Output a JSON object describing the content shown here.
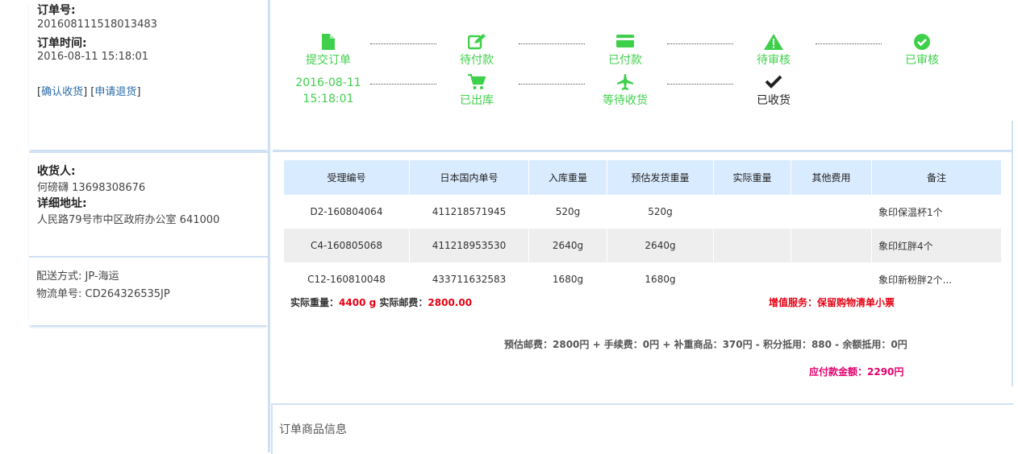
{
  "order": {
    "number_label": "订单号:",
    "number": "201608111518013483",
    "time_label": "订单时间:",
    "time": "2016-08-11 15:18:01",
    "confirm_link": "确认收货",
    "return_link": "申请退货"
  },
  "receiver": {
    "name_label": "收货人:",
    "name": "何磅礴",
    "phone": "13698308676",
    "address_label": "详细地址:",
    "address": "人民路79号市中区政府办公室 641000"
  },
  "shipping": {
    "method": "配送方式: JP-海运",
    "tracking": "物流单号: CD264326535JP"
  },
  "progress": {
    "row1": [
      {
        "label": "提交订单",
        "icon": "file-icon",
        "glyph": "▮"
      },
      {
        "label": "待付款",
        "icon": "edit-icon",
        "glyph": "✎"
      },
      {
        "label": "已付款",
        "icon": "credit-card-icon",
        "glyph": "▬"
      },
      {
        "label": "待审核",
        "icon": "warning-icon",
        "glyph": "⚠"
      },
      {
        "label": "已审核",
        "icon": "check-circle-icon",
        "glyph": "✔"
      }
    ],
    "row1_first_date": "2016-08-11",
    "row1_first_time": "15:18:01",
    "row2": [
      {
        "label": "已出库",
        "icon": "cart-icon",
        "glyph": "🛒"
      },
      {
        "label": "等待收货",
        "icon": "plane-icon",
        "glyph": "✈"
      },
      {
        "label": "已收货",
        "icon": "check-icon",
        "glyph": "✔"
      }
    ],
    "active_color": "#3fd04b"
  },
  "table": {
    "headers": [
      "受理编号",
      "日本国内单号",
      "入库重量",
      "预估发货重量",
      "实际重量",
      "其他费用",
      "备注"
    ],
    "rows": [
      [
        "D2-160804064",
        "411218571945",
        "520g",
        "520g",
        "",
        "",
        "象印保温杯1个"
      ],
      [
        "C4-160805068",
        "411218953530",
        "2640g",
        "2640g",
        "",
        "",
        "象印红胖4个"
      ],
      [
        "C12-160810048",
        "433711632583",
        "1680g",
        "1680g",
        "",
        "",
        "象印新粉胖2个..."
      ]
    ]
  },
  "summary": {
    "actual_weight_label": "实际重量：",
    "actual_weight": "4400 g",
    "actual_postage_label": "实际邮费：",
    "actual_postage": "2800.00",
    "value_added": "增值服务：保留购物清单小票",
    "estimate_line": "预估邮费：2800円 + 手续费：0円 + 补重商品：370円 - 积分抵用：880 - 余额抵用：0円",
    "payable": "应付款金额：2290円"
  },
  "goods_section": {
    "title": "订单商品信息"
  },
  "colors": {
    "header_bg": "#d9ebff",
    "divider": "#cfe0f5",
    "red": "#e60012",
    "pink": "#e4006c"
  }
}
